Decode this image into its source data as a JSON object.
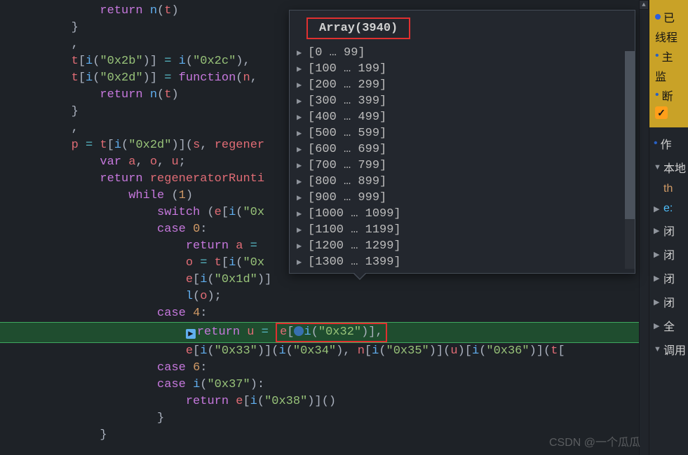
{
  "code": {
    "l1": "return",
    "l1b": "n",
    "l1c": "t",
    "l3": "t",
    "l3a": "i",
    "l3s": "\"0x2b\"",
    "l3b": "i",
    "l3s2": "\"0x2c\"",
    "l4": "t",
    "l4a": "i",
    "l4s": "\"0x2d\"",
    "l4fn": "function",
    "l4n": "n",
    "l5": "return",
    "l5b": "n",
    "l5c": "t",
    "l8p": "p",
    "l8t": "t",
    "l8i": "i",
    "l8s": "\"0x2d\"",
    "l8s2": "s",
    "l8r": "regener",
    "l9": "var",
    "l9a": "a",
    "l9o": "o",
    "l9u": "u",
    "l10": "return",
    "l10r": "regeneratorRunti",
    "l11": "while",
    "l11n": "1",
    "l12": "switch",
    "l12e": "e",
    "l12i": "i",
    "l12s": "\"0x",
    "l13": "case",
    "l13n": "0",
    "l14": "return",
    "l14a": "a",
    "l15o": "o",
    "l15t": "t",
    "l15i": "i",
    "l15s": "\"0x",
    "l16e": "e",
    "l16i": "i",
    "l16s": "\"0x1d\"",
    "l17l": "l",
    "l17o": "o",
    "l18": "case",
    "l18n": "4",
    "l19": "return",
    "l19u": "u",
    "l19e": "e",
    "l19i": "i",
    "l19s": "\"0x32\"",
    "l20e": "e",
    "l20i": "i",
    "l20s1": "\"0x33\"",
    "l20s2": "\"0x34\"",
    "l20n": "n",
    "l20s3": "\"0x35\"",
    "l20u": "u",
    "l20s4": "\"0x36\"",
    "l20t": "t",
    "l21": "case",
    "l21n": "6",
    "l22": "case",
    "l22i": "i",
    "l22s": "\"0x37\"",
    "l23": "return",
    "l23e": "e",
    "l23i": "i",
    "l23s": "\"0x38\""
  },
  "popup": {
    "title": "Array(3940)",
    "ranges": [
      "[0 … 99]",
      "[100 … 199]",
      "[200 … 299]",
      "[300 … 399]",
      "[400 … 499]",
      "[500 … 599]",
      "[600 … 699]",
      "[700 … 799]",
      "[800 … 899]",
      "[900 … 999]",
      "[1000 … 1099]",
      "[1100 … 1199]",
      "[1200 … 1299]",
      "[1300 … 1399]"
    ]
  },
  "sidebar": {
    "top_badge": "已",
    "gold": {
      "a": "线程",
      "b": "主",
      "c": "监",
      "d": "断"
    },
    "items": {
      "scope": "作",
      "local": "本地",
      "th": "th",
      "e": "e:",
      "close1": "闭",
      "close2": "闭",
      "close3": "闭",
      "close4": "闭",
      "global": "全",
      "call": "调用"
    }
  },
  "watermark": "CSDN @一个瓜瓜"
}
